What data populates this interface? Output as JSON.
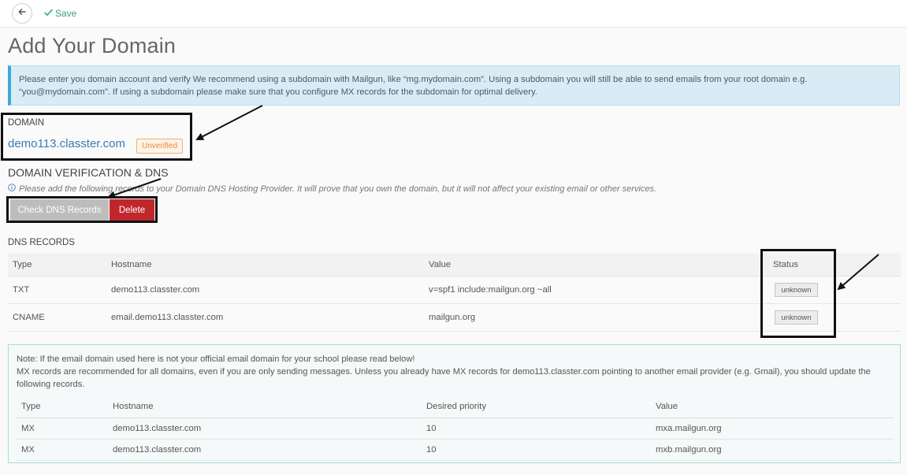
{
  "toolbar": {
    "save_label": "Save"
  },
  "page": {
    "title": "Add Your Domain"
  },
  "info": {
    "text": "Please enter you domain account and verify We recommend using a subdomain with Mailgun, like “mg.mydomain.com”. Using a subdomain you will still be able to send emails from your root domain e.g. “you@mydomain.com”. If using a subdomain please make sure that you configure MX records for the subdomain for optimal delivery."
  },
  "domain": {
    "label": "DOMAIN",
    "name": "demo113.classter.com",
    "status_badge": "Unverified"
  },
  "verification": {
    "title": "DOMAIN VERIFICATION & DNS",
    "hint": "Please add the following records to your Domain DNS Hosting Provider. It will prove that you own the domain, but it will not affect your existing email or other services.",
    "check_button": "Check DNS Records",
    "delete_button": "Delete"
  },
  "dns_records": {
    "label": "DNS RECORDS",
    "columns": [
      "Type",
      "Hostname",
      "Value",
      "Status"
    ],
    "rows": [
      {
        "type": "TXT",
        "hostname": "demo113.classter.com",
        "value": "v=spf1 include:mailgun.org ~all",
        "status": "unknown"
      },
      {
        "type": "CNAME",
        "hostname": "email.demo113.classter.com",
        "value": "mailgun.org",
        "status": "unknown"
      }
    ]
  },
  "mx_note": {
    "line1": "Note: If the email domain used here is not your official email domain for your school please read below!",
    "line2": "MX records are recommended for all domains, even if you are only sending messages. Unless you already have MX records for demo113.classter.com pointing to another email provider (e.g. Gmail), you should update the following records.",
    "columns": [
      "Type",
      "Hostname",
      "Desired priority",
      "Value"
    ],
    "rows": [
      {
        "type": "MX",
        "hostname": "demo113.classter.com",
        "priority": "10",
        "value": "mxa.mailgun.org"
      },
      {
        "type": "MX",
        "hostname": "demo113.classter.com",
        "priority": "10",
        "value": "mxb.mailgun.org"
      }
    ]
  },
  "colors": {
    "accent_link": "#3a7ab8",
    "save_green": "#3aa37a",
    "delete_red": "#c0272d",
    "unverified_orange": "#e8893a",
    "info_bg": "#d9ecf5"
  },
  "icons": [
    "back-arrow-icon",
    "checkmark-icon",
    "info-circle-icon"
  ]
}
